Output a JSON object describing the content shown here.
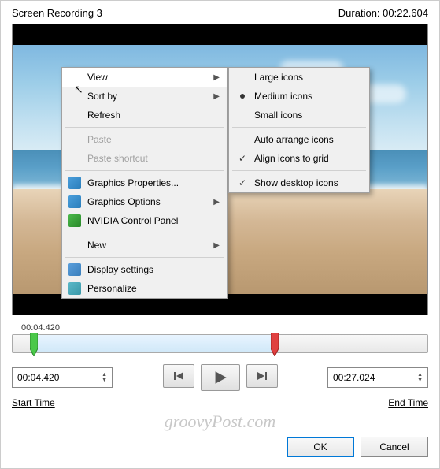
{
  "header": {
    "title": "Screen Recording 3",
    "duration_label": "Duration:",
    "duration": "00:22.604"
  },
  "context_menu": {
    "view": "View",
    "sort_by": "Sort by",
    "refresh": "Refresh",
    "paste": "Paste",
    "paste_shortcut": "Paste shortcut",
    "graphics_props": "Graphics Properties...",
    "graphics_opts": "Graphics Options",
    "nvidia": "NVIDIA Control Panel",
    "new": "New",
    "display_settings": "Display settings",
    "personalize": "Personalize"
  },
  "submenu": {
    "large": "Large icons",
    "medium": "Medium icons",
    "small": "Small icons",
    "auto_arrange": "Auto arrange icons",
    "align_grid": "Align icons to grid",
    "show_desktop": "Show desktop icons",
    "selected": "medium",
    "align_checked": true,
    "show_checked": true
  },
  "timeline": {
    "current_label": "00:04.420",
    "start_value": "00:04.420",
    "end_value": "00:27.024",
    "start_caption": "Start Time",
    "end_caption": "End Time"
  },
  "footer": {
    "ok": "OK",
    "cancel": "Cancel"
  },
  "watermark": "groovyPost.com"
}
